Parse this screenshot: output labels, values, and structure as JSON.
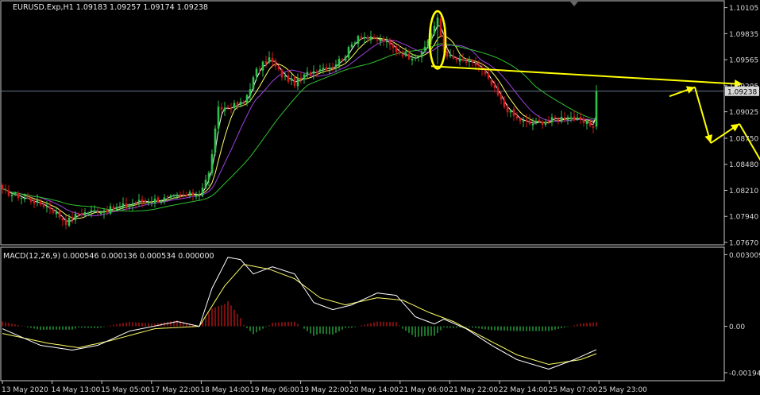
{
  "window": {
    "symbol_label": "EURUSD.Exp,H1  1.09183 1.09257 1.09174 1.09238"
  },
  "colors": {
    "background": "#000000",
    "frame": "#c8c8c8",
    "bull_candle": "#2ec24a",
    "bear_candle": "#d01818",
    "ma_fast": "#ffffff",
    "ma_yellow": "#ffff66",
    "ma_purple": "#a040e0",
    "ma_green": "#30c030",
    "annotation": "#ffff00",
    "price_line": "#8a9fb8",
    "macd_line": "#ffffff",
    "signal_line": "#ffff66",
    "hist_pos": "#d01818",
    "hist_neg": "#2ec24a"
  },
  "chart_data": [
    {
      "type": "candlestick",
      "panel": "price",
      "ylim": [
        1.0767,
        1.1011
      ],
      "y_ticks": [
        "1.10105",
        "1.09835",
        "1.09565",
        "1.09295",
        "1.09025",
        "1.08750",
        "1.08480",
        "1.08210",
        "1.07940",
        "1.07670"
      ],
      "current_price_label": "1.09238",
      "current_price": 1.09238,
      "x_ticks": [
        "13 May 2020",
        "14 May 13:00",
        "15 May 05:00",
        "17 May 22:00",
        "18 May 14:00",
        "19 May 06:00",
        "19 May 22:00",
        "20 May 14:00",
        "21 May 06:00",
        "21 May 22:00",
        "22 May 14:00",
        "25 May 07:00",
        "25 May 23:00"
      ],
      "bars": 188,
      "close_path": [
        [
          0,
          1.082
        ],
        [
          8,
          1.0812
        ],
        [
          15,
          1.0803
        ],
        [
          20,
          1.0788
        ],
        [
          24,
          1.0797
        ],
        [
          28,
          1.0799
        ],
        [
          35,
          1.0802
        ],
        [
          42,
          1.0809
        ],
        [
          48,
          1.0811
        ],
        [
          55,
          1.0814
        ],
        [
          58,
          1.0816
        ],
        [
          62,
          1.0818
        ],
        [
          65,
          1.0838
        ],
        [
          68,
          1.0905
        ],
        [
          72,
          1.0908
        ],
        [
          76,
          1.0912
        ],
        [
          80,
          1.0945
        ],
        [
          84,
          1.0958
        ],
        [
          88,
          1.094
        ],
        [
          92,
          1.0932
        ],
        [
          96,
          1.0942
        ],
        [
          100,
          1.0948
        ],
        [
          104,
          1.095
        ],
        [
          108,
          1.0962
        ],
        [
          112,
          1.0982
        ],
        [
          116,
          1.0978
        ],
        [
          120,
          1.0976
        ],
        [
          124,
          1.0966
        ],
        [
          128,
          1.096
        ],
        [
          132,
          1.0962
        ],
        [
          135,
          1.0985
        ],
        [
          137,
          1.0998
        ],
        [
          139,
          1.0965
        ],
        [
          142,
          1.0957
        ],
        [
          146,
          1.0954
        ],
        [
          150,
          1.095
        ],
        [
          154,
          1.093
        ],
        [
          158,
          1.0908
        ],
        [
          162,
          1.0895
        ],
        [
          166,
          1.089
        ],
        [
          170,
          1.0892
        ],
        [
          174,
          1.0895
        ],
        [
          178,
          1.0898
        ],
        [
          182,
          1.0892
        ],
        [
          186,
          1.0888
        ],
        [
          190,
          1.0895
        ],
        [
          194,
          1.0902
        ],
        [
          198,
          1.0906
        ],
        [
          202,
          1.0898
        ],
        [
          206,
          1.0902
        ],
        [
          210,
          1.0915
        ],
        [
          214,
          1.0924
        ]
      ],
      "moving_averages": [
        {
          "name": "fast",
          "lag": 3
        },
        {
          "name": "mid",
          "lag": 7
        },
        {
          "name": "slow",
          "lag": 13
        },
        {
          "name": "long",
          "lag": 30
        }
      ],
      "annotations": {
        "ellipse_bar": 137,
        "horizontal_line": [
          [
            135,
            1.09498
          ],
          [
            233,
            1.09313
          ]
        ],
        "projection": [
          [
            210,
            1.09185
          ],
          [
            218,
            1.0928
          ],
          [
            223,
            1.087
          ],
          [
            232,
            1.089
          ],
          [
            244,
            1.0822
          ]
        ]
      }
    },
    {
      "type": "macd",
      "panel": "indicator",
      "label": "MACD(12,26,9) 0.000546 0.000136 0.000534 0.000000",
      "ylim": [
        -0.00205,
        0.00309
      ],
      "y_ticks": [
        "0.003009",
        "0.00",
        "-0.001948"
      ],
      "macd_path": [
        [
          0,
          -0.0001
        ],
        [
          12,
          -0.0008
        ],
        [
          22,
          -0.001
        ],
        [
          30,
          -0.0008
        ],
        [
          40,
          -0.0002
        ],
        [
          55,
          0.0002
        ],
        [
          62,
          0.0
        ],
        [
          66,
          0.0016
        ],
        [
          71,
          0.0029
        ],
        [
          75,
          0.0028
        ],
        [
          79,
          0.0022
        ],
        [
          85,
          0.0025
        ],
        [
          92,
          0.0022
        ],
        [
          98,
          0.001
        ],
        [
          104,
          0.0007
        ],
        [
          110,
          0.0009
        ],
        [
          118,
          0.0014
        ],
        [
          124,
          0.0013
        ],
        [
          130,
          0.0004
        ],
        [
          136,
          0.0001
        ],
        [
          139,
          0.0003
        ],
        [
          146,
          -0.0001
        ],
        [
          154,
          -0.0008
        ],
        [
          162,
          -0.0014
        ],
        [
          172,
          -0.0018
        ],
        [
          180,
          -0.0014
        ],
        [
          190,
          -0.0008
        ],
        [
          198,
          -0.0003
        ],
        [
          206,
          0.0
        ],
        [
          214,
          0.0003
        ]
      ],
      "signal_path": [
        [
          0,
          -0.0003
        ],
        [
          14,
          -0.0007
        ],
        [
          24,
          -0.0009
        ],
        [
          34,
          -0.0006
        ],
        [
          48,
          -0.0001
        ],
        [
          62,
          0.0
        ],
        [
          70,
          0.0017
        ],
        [
          76,
          0.0026
        ],
        [
          84,
          0.0024
        ],
        [
          92,
          0.002
        ],
        [
          100,
          0.0012
        ],
        [
          108,
          0.0009
        ],
        [
          118,
          0.0012
        ],
        [
          126,
          0.0011
        ],
        [
          134,
          0.0006
        ],
        [
          142,
          0.0002
        ],
        [
          152,
          -0.0005
        ],
        [
          162,
          -0.0012
        ],
        [
          172,
          -0.0016
        ],
        [
          182,
          -0.0014
        ],
        [
          192,
          -0.0009
        ],
        [
          204,
          -0.0004
        ],
        [
          214,
          0.0
        ]
      ]
    }
  ]
}
